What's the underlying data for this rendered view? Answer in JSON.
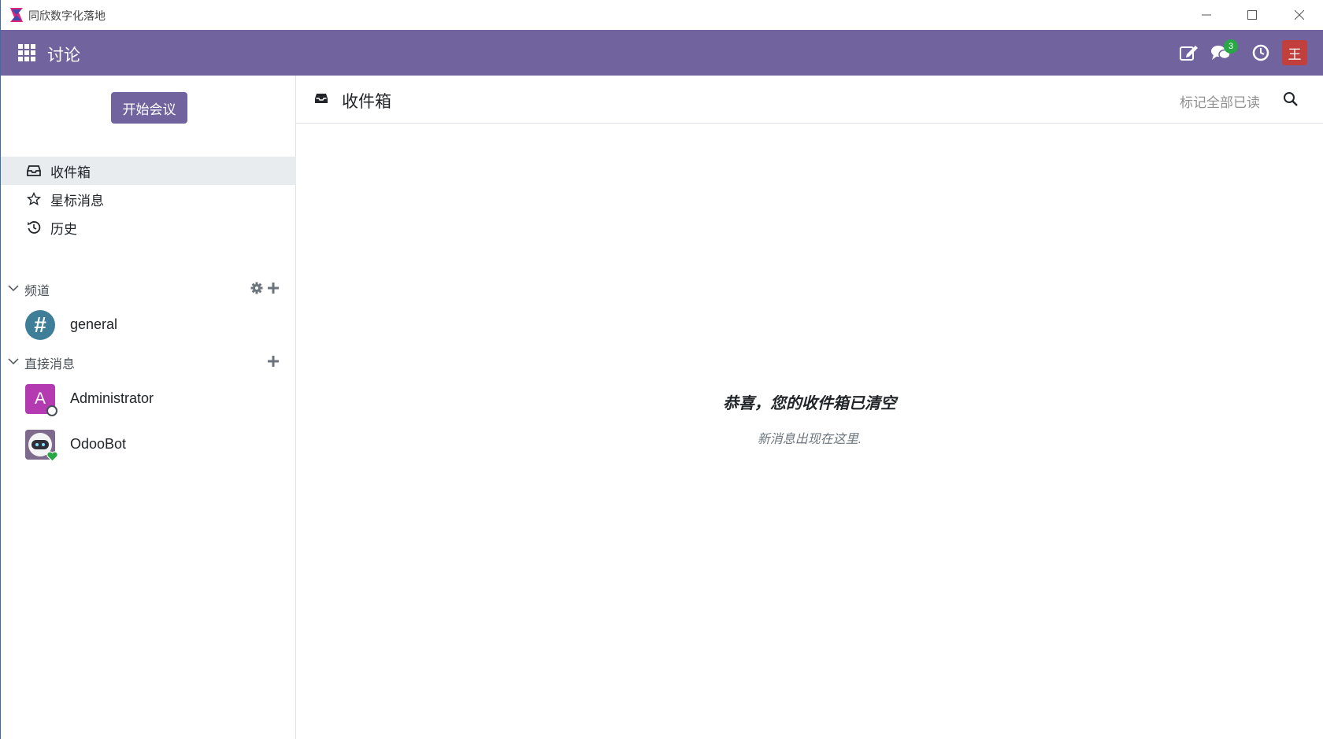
{
  "window": {
    "title": "同欣数字化落地",
    "controls": [
      "minimize-icon",
      "maximize-icon",
      "close-icon"
    ]
  },
  "navbar": {
    "app_title": "讨论",
    "icons": [
      "apps-grid-icon",
      "compose-icon",
      "chat-icon",
      "activity-clock-icon"
    ],
    "chat_badge_count": "3",
    "user_avatar_letter": "王",
    "colors": {
      "navbar_bg": "#71639e",
      "avatar_bg": "#c1403d",
      "badge_bg": "#28a745"
    }
  },
  "sidebar": {
    "start_meeting_label": "开始会议",
    "mailboxes": [
      {
        "label": "收件箱",
        "icon": "inbox-icon",
        "active": true
      },
      {
        "label": "星标消息",
        "icon": "star-icon",
        "active": false
      },
      {
        "label": "历史",
        "icon": "history-icon",
        "active": false
      }
    ],
    "channels": {
      "header": "频道",
      "items": [
        {
          "label": "general",
          "avatar_glyph": "#"
        }
      ]
    },
    "direct_messages": {
      "header": "直接消息",
      "items": [
        {
          "label": "Administrator",
          "avatar_letter": "A",
          "status": "offline"
        },
        {
          "label": "OdooBot",
          "status": "online"
        }
      ]
    }
  },
  "main": {
    "header": {
      "title": "收件箱",
      "mark_all_read": "标记全部已读"
    },
    "empty_state": {
      "title": "恭喜，您的收件箱已清空",
      "subtitle": "新消息出现在这里."
    }
  }
}
